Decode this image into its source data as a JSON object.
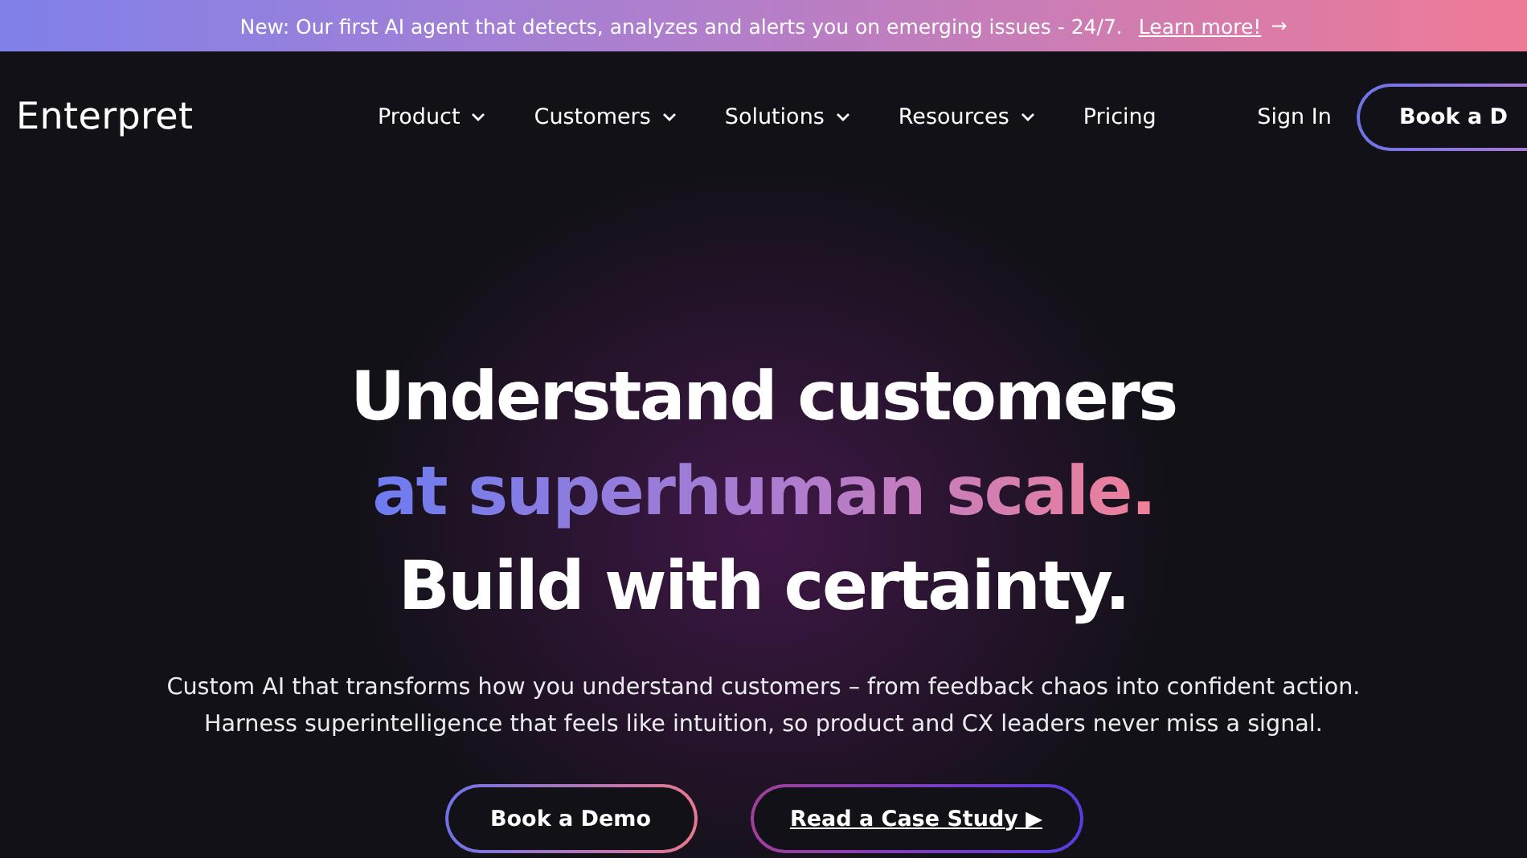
{
  "announcement": {
    "text": "New: Our first AI agent that detects, analyzes and alerts you on emerging issues - 24/7.",
    "link": "Learn more!",
    "arrow": "→"
  },
  "nav": {
    "logo": "Enterpret",
    "items": [
      {
        "label": "Product",
        "dropdown": true
      },
      {
        "label": "Customers",
        "dropdown": true
      },
      {
        "label": "Solutions",
        "dropdown": true
      },
      {
        "label": "Resources",
        "dropdown": true
      },
      {
        "label": "Pricing",
        "dropdown": false
      }
    ],
    "sign_in": "Sign In",
    "cta": "Book a D"
  },
  "hero": {
    "lines": [
      {
        "text": "Understand customers",
        "kind": "plain"
      },
      {
        "text": "at superhuman scale.",
        "kind": "gradient"
      },
      {
        "text": "Build with certainty.",
        "kind": "plain"
      }
    ],
    "paragraph": [
      "Custom AI that transforms how you understand customers – from feedback chaos into confident action.",
      "Harness superintelligence that feels like intuition, so product and CX leaders never miss a signal."
    ],
    "buttons": [
      {
        "label": "Book a Demo",
        "kind": "primary"
      },
      {
        "label": "Read a Case Study ▶",
        "kind": "link"
      }
    ]
  }
}
